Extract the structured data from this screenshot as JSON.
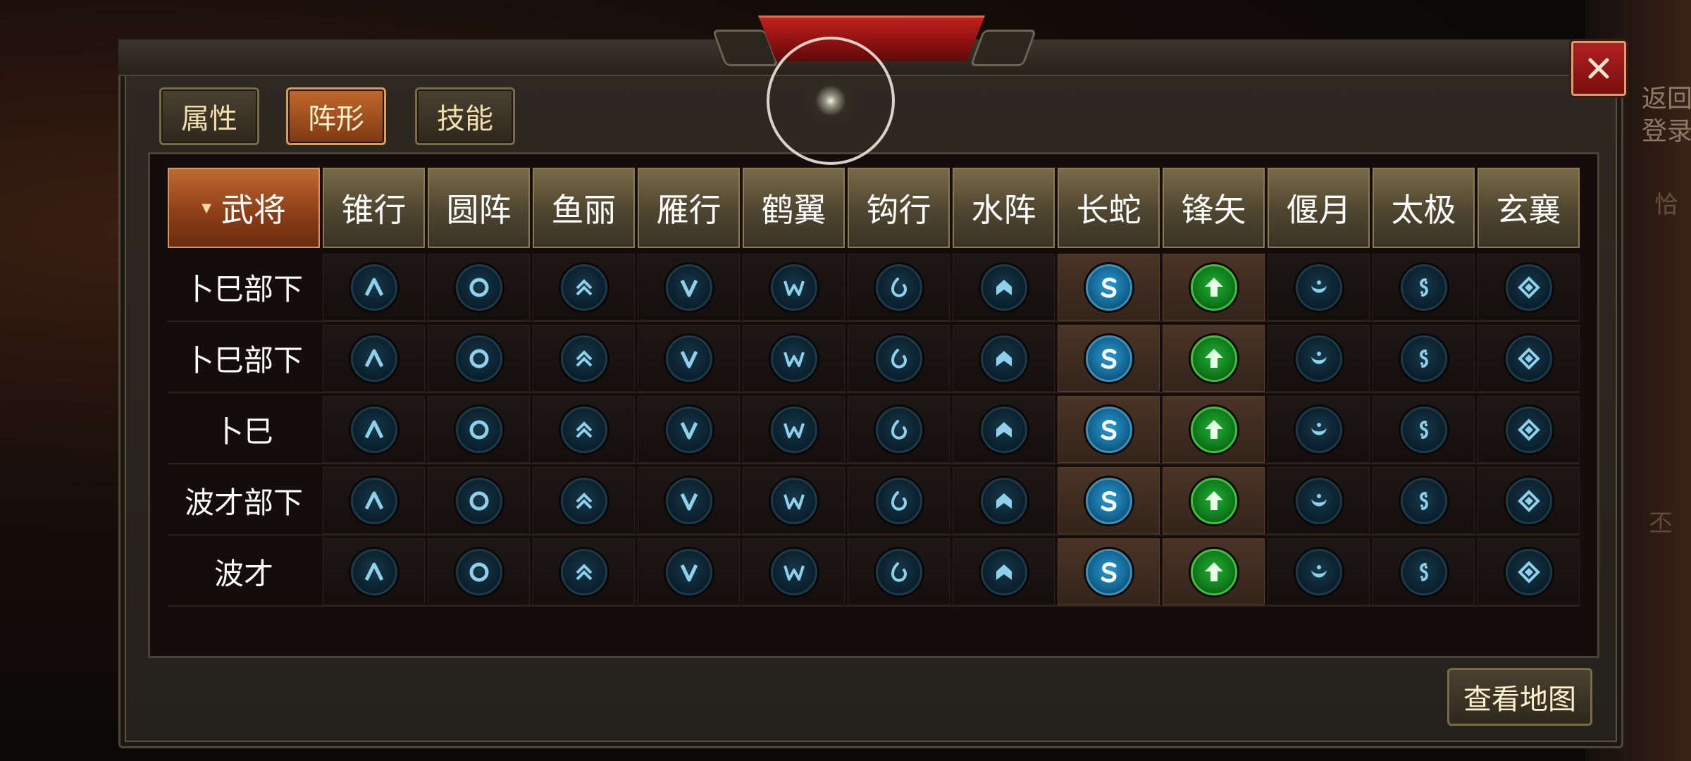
{
  "side_labels": {
    "top": "返回\n登录",
    "mid": "恰",
    "low": "丕"
  },
  "tabs": [
    {
      "label": "属性",
      "active": false
    },
    {
      "label": "阵形",
      "active": true
    },
    {
      "label": "技能",
      "active": false
    }
  ],
  "table": {
    "first_header": "武将",
    "formations": [
      "锥行",
      "圆阵",
      "鱼丽",
      "雁行",
      "鹤翼",
      "钩行",
      "水阵",
      "长蛇",
      "锋矢",
      "偃月",
      "太极",
      "玄襄"
    ],
    "icons": [
      "caret-up-icon",
      "ring-icon",
      "chevron-stack-icon",
      "v-icon",
      "w-icon",
      "hook-icon",
      "arch-icon",
      "snake-s-icon",
      "up-arrow-icon",
      "crescent-icon",
      "taiji-icon",
      "diamond-icon"
    ],
    "rows": [
      {
        "name": "卜巳部下",
        "highlight": [
          "长蛇",
          "锋矢"
        ]
      },
      {
        "name": "卜巳部下",
        "highlight": [
          "长蛇",
          "锋矢"
        ]
      },
      {
        "name": "卜巳",
        "highlight": [
          "长蛇",
          "锋矢"
        ]
      },
      {
        "name": "波才部下",
        "highlight": [
          "长蛇",
          "锋矢"
        ]
      },
      {
        "name": "波才",
        "highlight": [
          "长蛇",
          "锋矢"
        ]
      }
    ]
  },
  "map_button": "查看地图",
  "colors": {
    "accent": "#c2692c",
    "close": "#b02020",
    "active_green": "#1fb030",
    "active_blue": "#2a9ad0"
  }
}
